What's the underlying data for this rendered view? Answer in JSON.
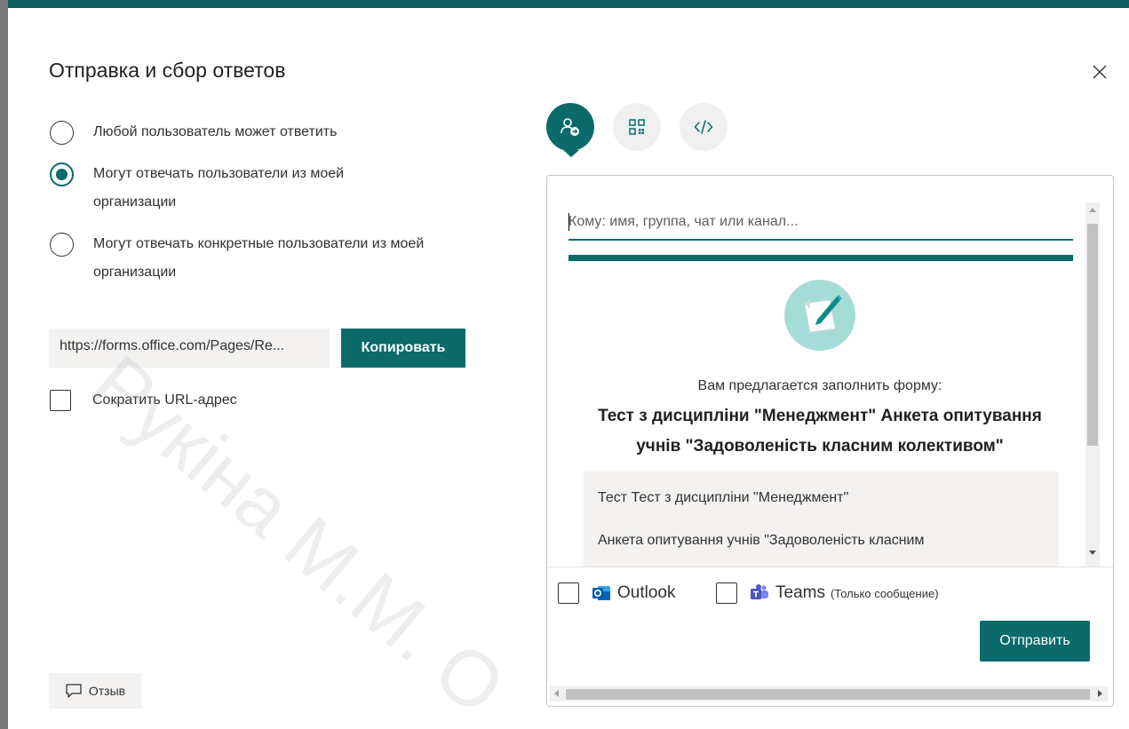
{
  "dialog": {
    "title": "Отправка и сбор ответов",
    "close_icon": "close-icon"
  },
  "permissions": {
    "options": [
      {
        "label": "Любой пользователь может ответить",
        "checked": false
      },
      {
        "label": "Могут отвечать пользователи из моей организации",
        "checked": true
      },
      {
        "label": "Могут отвечать конкретные пользователи из моей организации",
        "checked": false
      }
    ]
  },
  "link": {
    "url": "https://forms.office.com/Pages/Re...",
    "copy_label": "Копировать",
    "shorten_label": "Сократить URL-адрес",
    "shorten_checked": false
  },
  "feedback": {
    "label": "Отзыв",
    "icon": "comment-icon"
  },
  "tabs": [
    {
      "name": "share-person-icon",
      "active": true
    },
    {
      "name": "qr-code-icon",
      "active": false
    },
    {
      "name": "embed-code-icon",
      "active": false
    }
  ],
  "share_panel": {
    "to_placeholder": "Кому: имя, группа, чат или канал...",
    "invite_text": "Вам предлагается заполнить форму:",
    "form_title": "Тест з дисципліни \"Менеджмент\" Анкета опитування учнів \"Задоволеність класним колективом\"",
    "description_line1": "Тест Тест з дисципліни \"Менеджмент\"",
    "description_line2": "Анкета опитування учнів \"Задоволеність класним",
    "outlook_label": "Outlook",
    "teams_label": "Teams",
    "teams_note": "(Только сообщение)",
    "send_label": "Отправить"
  },
  "colors": {
    "accent": "#0b6a6a",
    "frame_top": "#0b5d5f"
  },
  "watermark": "Рукіна М.М. О"
}
